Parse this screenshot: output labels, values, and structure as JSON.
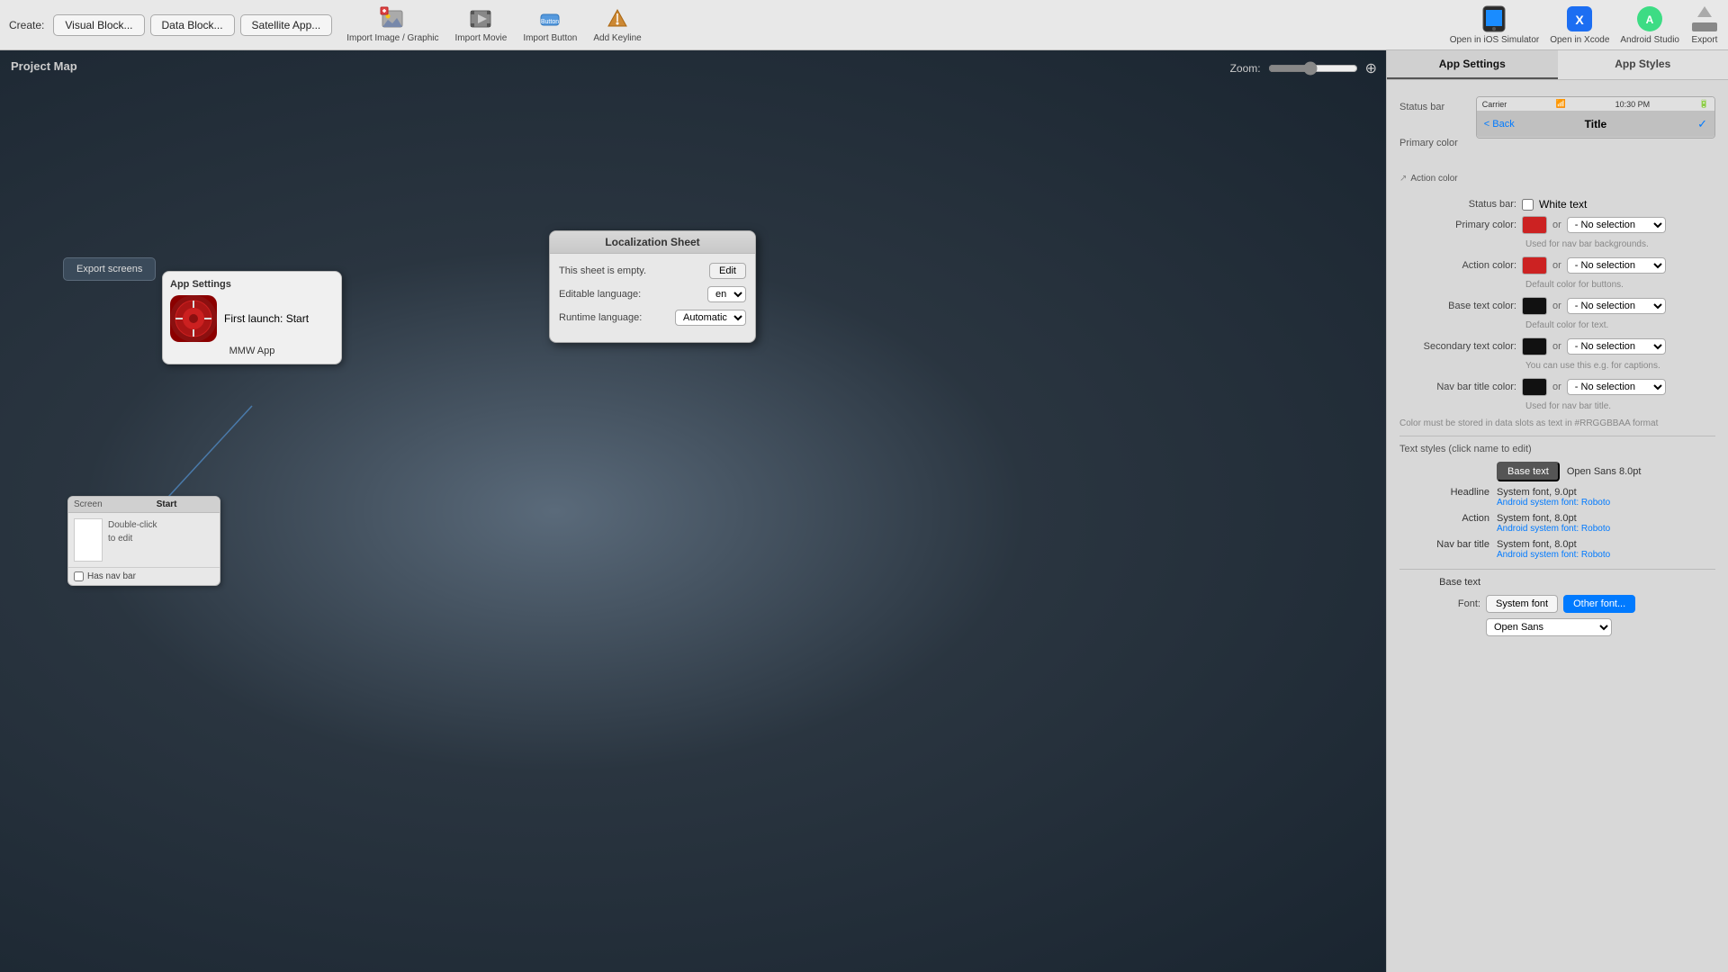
{
  "toolbar": {
    "create_label": "Create:",
    "visual_block_btn": "Visual Block...",
    "data_block_btn": "Data Block...",
    "satellite_app_btn": "Satellite App...",
    "import_image_label": "Import Image / Graphic",
    "import_movie_label": "Import Movie",
    "import_button_label": "Import Button",
    "add_keyline_label": "Add Keyline",
    "open_ios_label": "Open in iOS Simulator",
    "open_xcode_label": "Open in Xcode",
    "android_studio_label": "Android Studio",
    "export_label": "Export"
  },
  "canvas": {
    "title": "Project Map",
    "zoom_label": "Zoom:"
  },
  "nodes": {
    "export_screens": "Export screens",
    "app_settings_title": "App Settings",
    "app_name": "MMW App",
    "first_launch_label": "First launch:",
    "first_launch_value": "Start",
    "screen_type": "Screen",
    "screen_name": "Start",
    "double_click": "Double-click",
    "to_edit": "to edit",
    "has_nav_bar": "Has nav bar"
  },
  "localization": {
    "title": "Localization Sheet",
    "empty_message": "This sheet is empty.",
    "editable_language_label": "Editable language:",
    "editable_language_value": "en",
    "runtime_language_label": "Runtime language:",
    "runtime_language_value": "Automatic",
    "edit_btn": "Edit"
  },
  "right_panel": {
    "tab_app_settings": "App Settings",
    "tab_app_styles": "App Styles",
    "status_bar_label": "Status bar",
    "primary_color_label": "Primary color",
    "action_color_label": "Action color",
    "ios_status_carrier": "Carrier",
    "ios_status_wifi": "WiFi",
    "ios_status_time": "10:30 PM",
    "ios_status_battery": "Battery",
    "ios_back": "< Back",
    "ios_title": "Title",
    "ios_action": "✓",
    "ios_action_color_label": "Action color",
    "status_bar_section_label": "Status bar:",
    "white_text_label": "White text",
    "primary_color_section_label": "Primary color:",
    "primary_color_swatch": "#cc2222",
    "primary_color_no_selection": "- No selection",
    "primary_color_hint": "Used for nav bar backgrounds.",
    "action_color_section_label": "Action color:",
    "action_color_swatch": "#cc2222",
    "action_color_no_selection": "- No selection",
    "action_color_hint": "Default color for buttons.",
    "base_text_color_label": "Base text color:",
    "base_text_color_swatch": "#111111",
    "base_text_no_selection": "- No selection",
    "base_text_hint": "Default color for text.",
    "secondary_text_label": "Secondary text color:",
    "secondary_text_swatch": "#111111",
    "secondary_text_no_selection": "- No selection",
    "secondary_text_hint": "You can use this e.g. for captions.",
    "nav_bar_title_label": "Nav bar title color:",
    "nav_bar_title_swatch": "#111111",
    "nav_bar_title_no_selection": "- No selection",
    "nav_bar_title_hint1": "Used for nav bar title.",
    "nav_bar_title_hint2": "Color must be stored in data slots as text in #RRGGBBAA format",
    "text_styles_label": "Text styles (click name to edit)",
    "base_text_active": "Base text",
    "base_text_font": "Open Sans 8.0pt",
    "headline_label": "Headline",
    "headline_font": "System font,  9.0pt",
    "headline_android": "Android system font: Roboto",
    "action_label": "Action",
    "action_font": "System font,  8.0pt",
    "action_android": "Android system font: Roboto",
    "nav_bar_title_style_label": "Nav bar title",
    "nav_bar_title_style_font": "System font,  8.0pt",
    "nav_bar_title_style_android": "Android system font: Roboto",
    "base_text_section": "Base text",
    "font_label": "Font:",
    "system_font_btn": "System font",
    "other_font_btn": "Other font...",
    "font_select_value": "Open Sans"
  }
}
